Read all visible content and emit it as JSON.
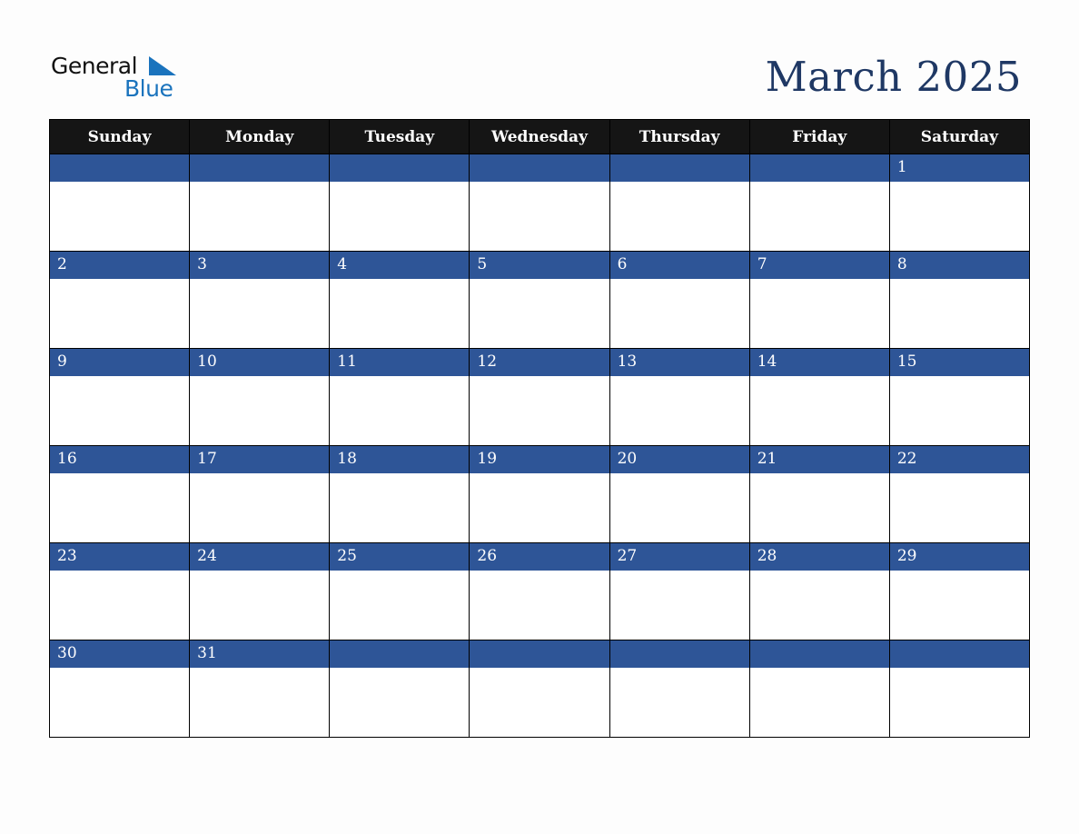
{
  "logo": {
    "line1": "General",
    "line2": "Blue",
    "icon": "triangle-flag-icon",
    "color": "#1a73bd"
  },
  "title": "March 2025",
  "colors": {
    "header_bg": "#151515",
    "band_bg": "#2e5597",
    "title": "#1f3864"
  },
  "weekdays": [
    "Sunday",
    "Monday",
    "Tuesday",
    "Wednesday",
    "Thursday",
    "Friday",
    "Saturday"
  ],
  "weeks": [
    [
      "",
      "",
      "",
      "",
      "",
      "",
      "1"
    ],
    [
      "2",
      "3",
      "4",
      "5",
      "6",
      "7",
      "8"
    ],
    [
      "9",
      "10",
      "11",
      "12",
      "13",
      "14",
      "15"
    ],
    [
      "16",
      "17",
      "18",
      "19",
      "20",
      "21",
      "22"
    ],
    [
      "23",
      "24",
      "25",
      "26",
      "27",
      "28",
      "29"
    ],
    [
      "30",
      "31",
      "",
      "",
      "",
      "",
      ""
    ]
  ]
}
